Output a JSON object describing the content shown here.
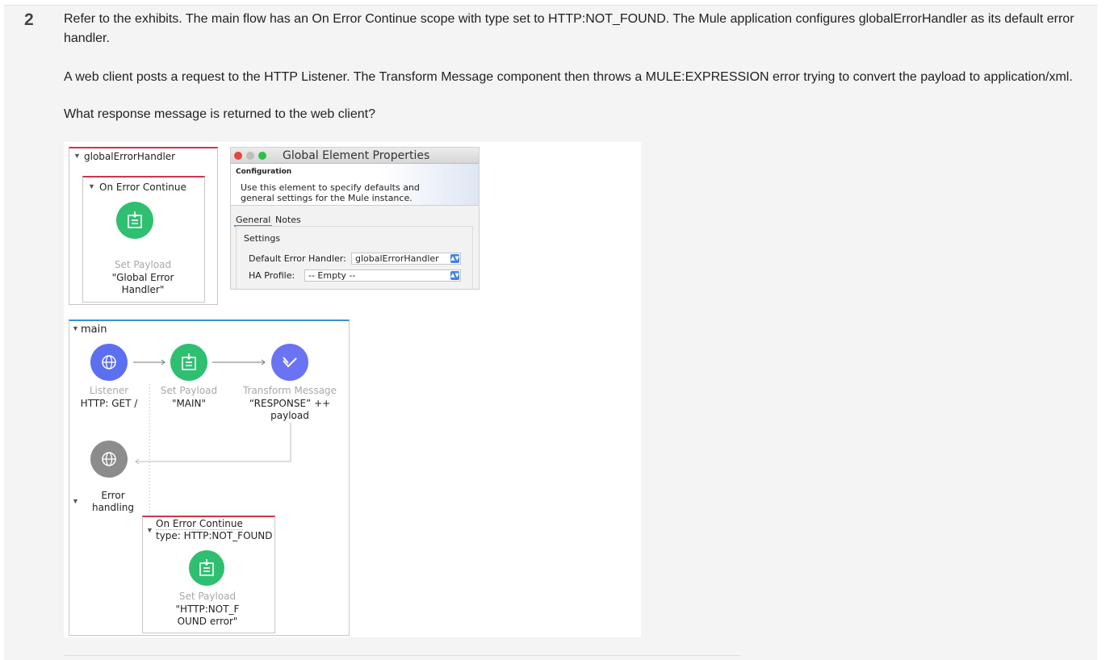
{
  "question": {
    "number": "2",
    "paragraph1": "Refer to the exhibits. The main flow has an On Error Continue scope with type set to HTTP:NOT_FOUND. The Mule application configures globalErrorHandler as its default error handler.",
    "paragraph2": "A web client posts a request to the HTTP Listener. The Transform Message component then throws a MULE:EXPRESSION error trying to convert the payload to application/xml.",
    "paragraph3": "What response message is returned to the web client?"
  },
  "global_handler": {
    "title": "globalErrorHandler",
    "scope_title": "On Error Continue",
    "component_type": "Set Payload",
    "component_value_line1": "\"Global Error",
    "component_value_line2": "Handler\""
  },
  "gep_window": {
    "title": "Global Element Properties",
    "section": "Configuration",
    "desc_line1": "Use this element to specify defaults and",
    "desc_line2": "general settings for the Mule instance.",
    "tab_general": "General",
    "tab_notes": "Notes",
    "settings_label": "Settings",
    "default_error_handler_label": "Default Error Handler:",
    "default_error_handler_value": "globalErrorHandler",
    "ha_profile_label": "HA Profile:",
    "ha_profile_value": "-- Empty --"
  },
  "main_flow": {
    "title": "main",
    "listener_type": "Listener",
    "listener_value": "HTTP: GET /",
    "set_payload_type": "Set Payload",
    "set_payload_value": "\"MAIN\"",
    "transform_type": "Transform Message",
    "transform_value_line1": "“RESPONSE” ++",
    "transform_value_line2": "payload",
    "error_handling_line1": "Error",
    "error_handling_line2": "handling",
    "scope_title": "On Error Continue",
    "scope_type": "type: HTTP:NOT_FOUND",
    "error_payload_type": "Set Payload",
    "error_payload_line1": "\"HTTP:NOT_F",
    "error_payload_line2": "OUND error\""
  },
  "colors": {
    "scope_border": "#d2334a",
    "flow_border": "#3b8fd6",
    "green": "#2fbf71",
    "blue": "#5b6ff0"
  },
  "icons": [
    "set-payload-icon",
    "http-listener-icon",
    "transform-message-icon",
    "close-dot-icon"
  ]
}
